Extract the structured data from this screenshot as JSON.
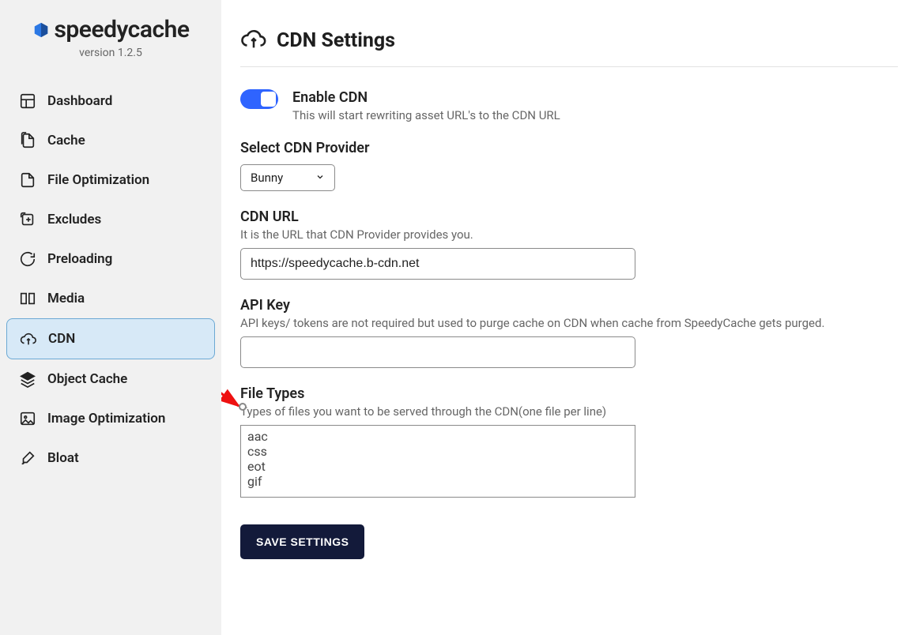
{
  "brand": {
    "name": "speedycache",
    "version": "version 1.2.5"
  },
  "sidebar": {
    "items": [
      {
        "label": "Dashboard"
      },
      {
        "label": "Cache"
      },
      {
        "label": "File Optimization"
      },
      {
        "label": "Excludes"
      },
      {
        "label": "Preloading"
      },
      {
        "label": "Media"
      },
      {
        "label": "CDN"
      },
      {
        "label": "Object Cache"
      },
      {
        "label": "Image Optimization"
      },
      {
        "label": "Bloat"
      }
    ]
  },
  "page": {
    "title": "CDN Settings"
  },
  "enable": {
    "title": "Enable CDN",
    "desc": "This will start rewriting asset URL's to the CDN URL",
    "on": true
  },
  "provider": {
    "label": "Select CDN Provider",
    "selected": "Bunny"
  },
  "cdn_url": {
    "label": "CDN URL",
    "desc": "It is the URL that CDN Provider provides you.",
    "value": "https://speedycache.b-cdn.net"
  },
  "api_key": {
    "label": "API Key",
    "desc": "API keys/ tokens are not required but used to purge cache on CDN when cache from SpeedyCache gets purged.",
    "value": ""
  },
  "file_types": {
    "label": "File Types",
    "desc": "Types of files you want to be served through the CDN(one file per line)",
    "value": "aac\ncss\neot\ngif"
  },
  "actions": {
    "save": "SAVE SETTINGS"
  }
}
